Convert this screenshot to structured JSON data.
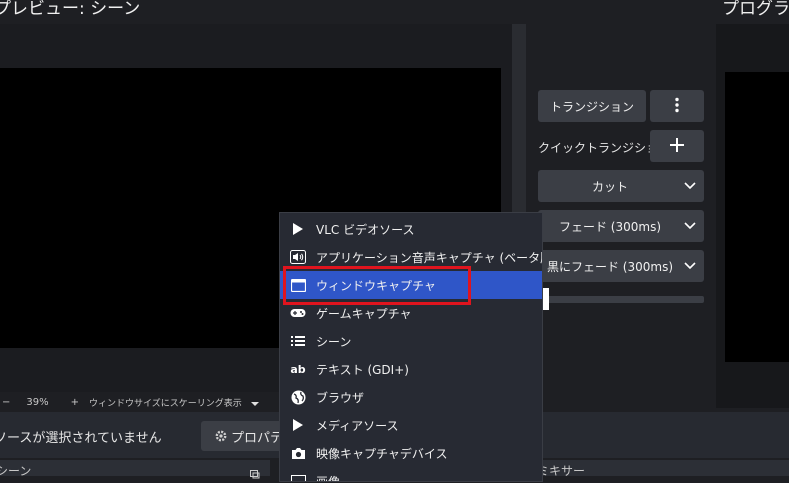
{
  "preview": {
    "title": "プレビュー: シーン"
  },
  "program": {
    "title": "プログラム"
  },
  "zoom_bar": {
    "minus": "−",
    "zoom": "39%",
    "plus": "+",
    "scaling_label": "ウィンドウサイズにスケーリング表示"
  },
  "status": {
    "no_source": "ソースが選択されていません",
    "properties": "プロパティ"
  },
  "docks": {
    "scenes_header": "シーン",
    "mixer_header": "ミキサー"
  },
  "transitions": {
    "transition_button": "トランジション",
    "quick_label": "クイックトランジション",
    "cut": "カット",
    "fade": "フェード (300ms)",
    "fade_black": "黒にフェード (300ms)"
  },
  "context_menu": {
    "items": [
      {
        "label": "VLC ビデオソース",
        "icon": "play-icon"
      },
      {
        "label": "アプリケーション音声キャプチャ (ベータ版)",
        "icon": "speaker-icon"
      },
      {
        "label": "ウィンドウキャプチャ",
        "icon": "window-icon",
        "selected": true
      },
      {
        "label": "ゲームキャプチャ",
        "icon": "gamepad-icon"
      },
      {
        "label": "シーン",
        "icon": "list-icon"
      },
      {
        "label": "テキスト (GDI+)",
        "icon": "text-icon"
      },
      {
        "label": "ブラウザ",
        "icon": "globe-icon"
      },
      {
        "label": "メディアソース",
        "icon": "play-icon"
      },
      {
        "label": "映像キャプチャデバイス",
        "icon": "camera-icon"
      },
      {
        "label": "画像",
        "icon": "image-icon"
      }
    ]
  },
  "colors": {
    "highlight": "#2f56c8",
    "annotation_box": "#e0141e"
  }
}
